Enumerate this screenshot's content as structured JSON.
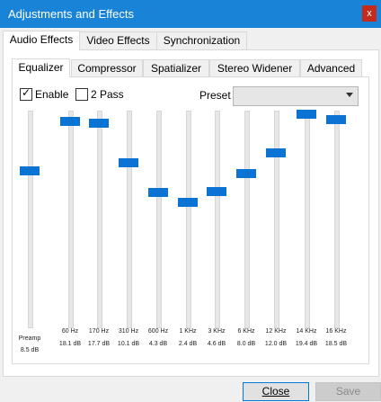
{
  "window": {
    "title": "Adjustments and Effects",
    "close_label": "x"
  },
  "outer_tabs": [
    "Audio Effects",
    "Video Effects",
    "Synchronization"
  ],
  "inner_tabs": [
    "Equalizer",
    "Compressor",
    "Spatializer",
    "Stereo Widener",
    "Advanced"
  ],
  "options": {
    "enable_label": "Enable",
    "enable_checked": true,
    "two_pass_label": "2 Pass",
    "two_pass_checked": false,
    "preset_label": "Preset",
    "preset_value": ""
  },
  "preamp": {
    "label": "Preamp",
    "value": "8.5 dB",
    "db": 8.5
  },
  "bands": [
    {
      "freq": "60 Hz",
      "value": "18.1 dB",
      "db": 18.1
    },
    {
      "freq": "170 Hz",
      "value": "17.7 dB",
      "db": 17.7
    },
    {
      "freq": "310 Hz",
      "value": "10.1 dB",
      "db": 10.1
    },
    {
      "freq": "600 Hz",
      "value": "4.3 dB",
      "db": 4.3
    },
    {
      "freq": "1 KHz",
      "value": "2.4 dB",
      "db": 2.4
    },
    {
      "freq": "3 KHz",
      "value": "4.6 dB",
      "db": 4.6
    },
    {
      "freq": "6 KHz",
      "value": "8.0 dB",
      "db": 8.0
    },
    {
      "freq": "12 KHz",
      "value": "12.0 dB",
      "db": 12.0
    },
    {
      "freq": "14 KHz",
      "value": "19.4 dB",
      "db": 19.4
    },
    {
      "freq": "16 KHz",
      "value": "18.5 dB",
      "db": 18.5
    }
  ],
  "db_range": [
    -20,
    20
  ],
  "buttons": {
    "close": "Close",
    "save": "Save"
  },
  "colors": {
    "titlebar": "#1883d7",
    "slider_thumb": "#0a73d4",
    "close_button": "#c42b1c"
  }
}
